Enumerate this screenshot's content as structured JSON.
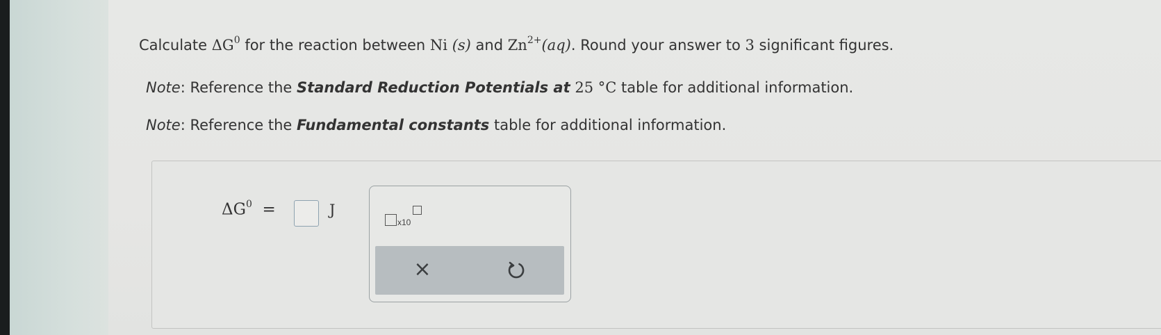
{
  "question": {
    "line1": {
      "pre": "Calculate ",
      "delta_g": "ΔG",
      "delta_g_sup": "0",
      "mid1": " for the reaction between ",
      "ni": "Ni",
      "ni_state": "(s)",
      "and": " and ",
      "zn": "Zn",
      "zn_charge": "2+",
      "zn_state": "(aq)",
      "post": ". Round your answer to ",
      "sig_figs": "3",
      "end": " significant figures."
    },
    "note1": {
      "label": "Note",
      "pre": ": Reference the ",
      "table": "Standard Reduction Potentials at",
      "temp": "25 °C",
      "post": " table for additional information."
    },
    "note2": {
      "label": "Note",
      "pre": ": Reference the ",
      "table": "Fundamental constants",
      "post": " table for additional information."
    }
  },
  "answer": {
    "symbol": "ΔG",
    "symbol_sup": "0",
    "equals": "=",
    "value": "",
    "unit": "J"
  },
  "toolbar": {
    "sci_notation_label": "x10",
    "clear_label": "×",
    "undo_icon": "undo-icon"
  }
}
